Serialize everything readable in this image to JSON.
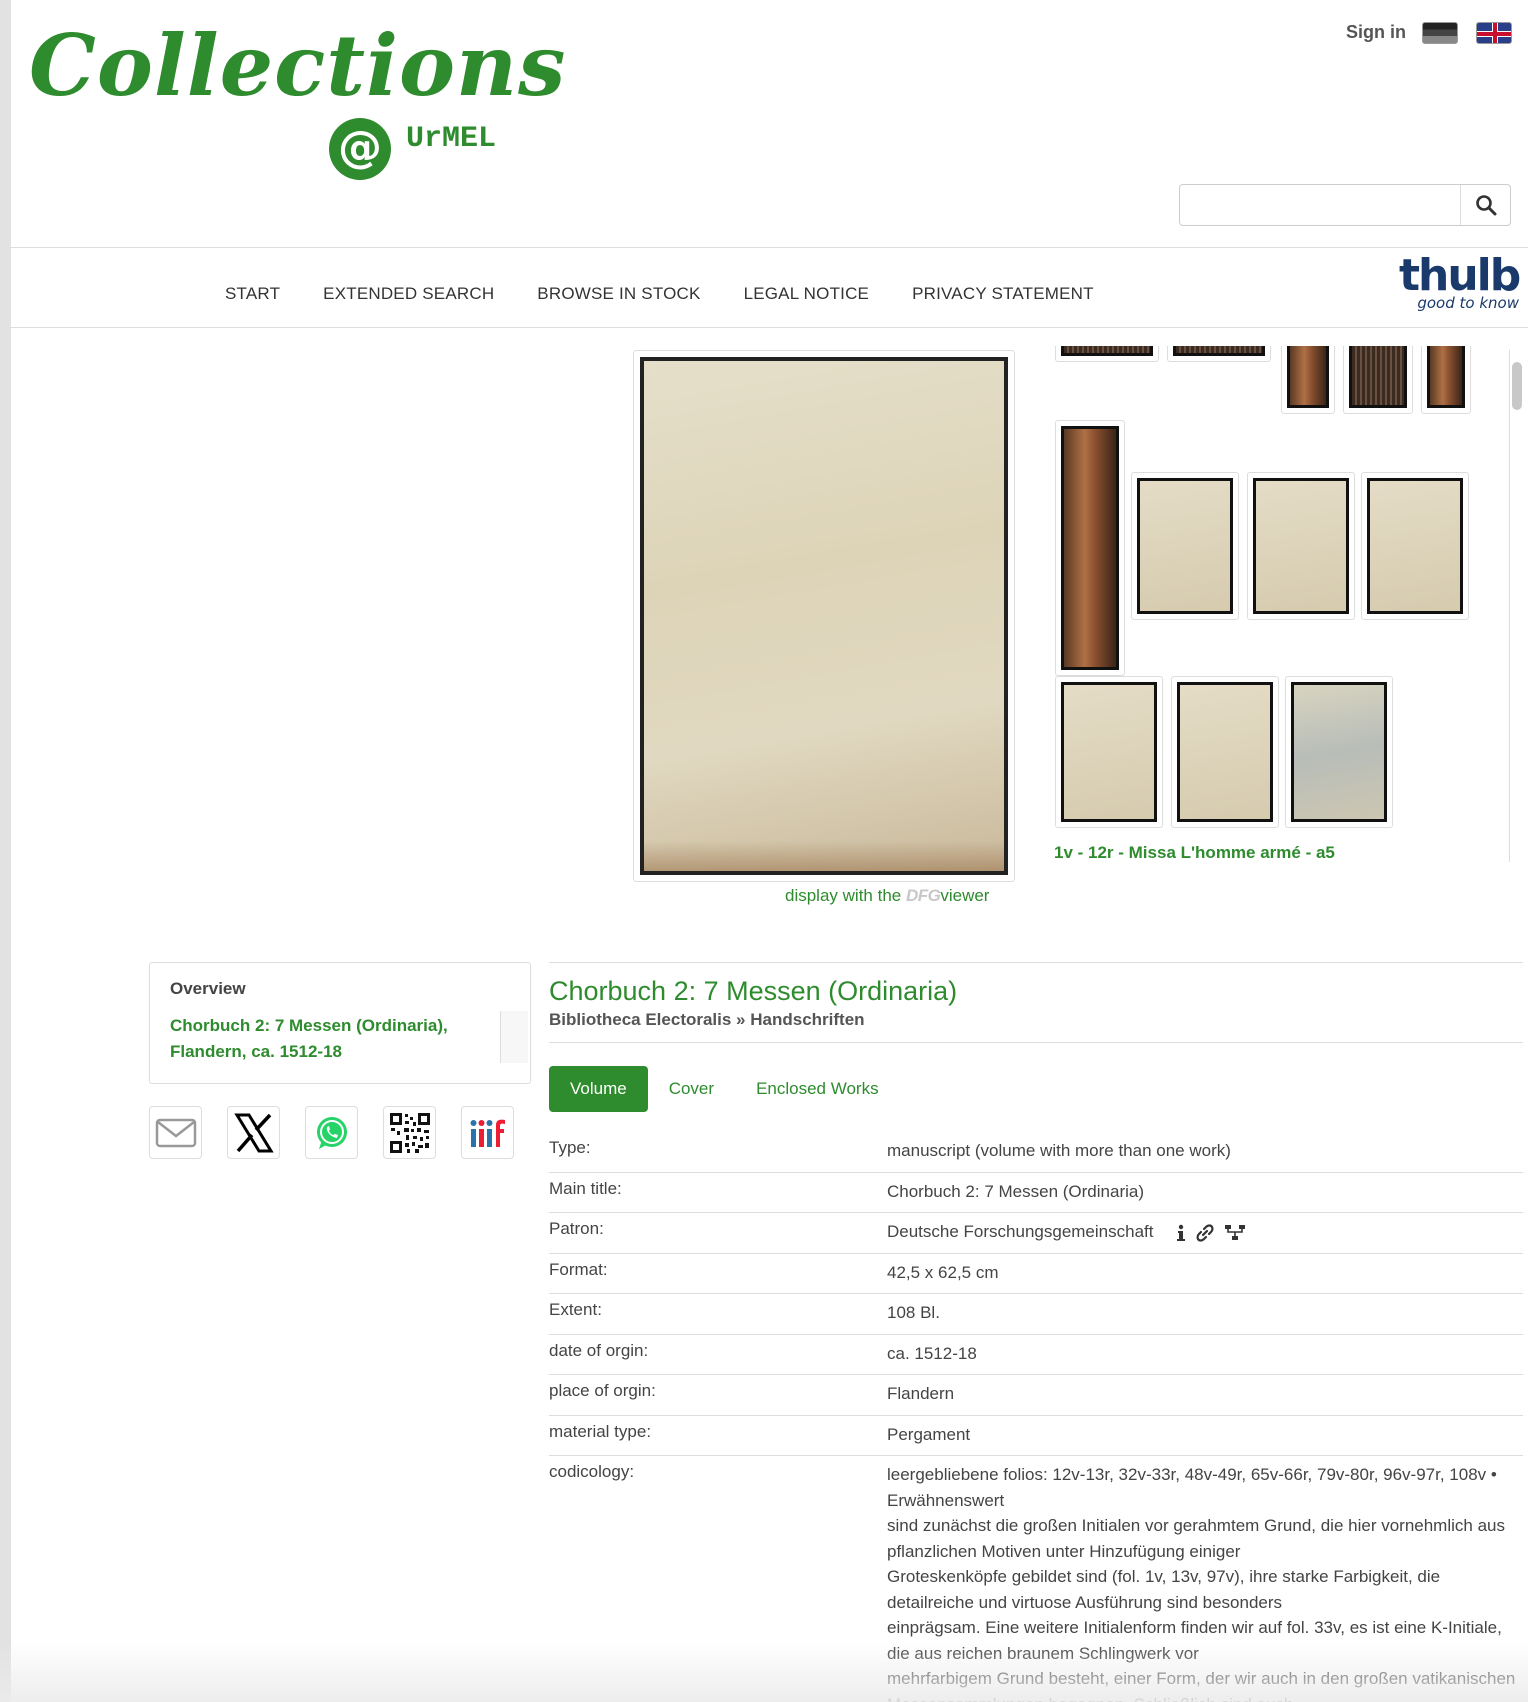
{
  "header": {
    "logo_script": "Collections",
    "logo_at": "@",
    "logo_sub": "UrMEL",
    "signin": "Sign in",
    "flag_de": "german-flag",
    "flag_uk": "uk-flag",
    "search": {
      "placeholder": "",
      "value": ""
    }
  },
  "nav": {
    "items": [
      "START",
      "EXTENDED SEARCH",
      "BROWSE IN STOCK",
      "LEGAL NOTICE",
      "PRIVACY STATEMENT"
    ]
  },
  "thulb": {
    "main": "thulb",
    "sub": "good to know"
  },
  "viewer": {
    "dfg_prefix": "display with the ",
    "dfg_mark": "DFG",
    "dfg_suffix": "viewer",
    "thumb_caption": "1v - 12r - Missa L'homme armé - a5"
  },
  "sidebar": {
    "overview_title": "Overview",
    "overview_link": "Chorbuch 2: 7 Messen (Ordinaria), Flandern, ca. 1512-18",
    "share": [
      "email-icon",
      "x-icon",
      "whatsapp-icon",
      "qr-code-icon",
      "iiif-icon"
    ]
  },
  "detail": {
    "title": "Chorbuch 2: 7 Messen (Ordinaria)",
    "breadcrumb": "Bibliotheca Electoralis » Handschriften",
    "tabs": [
      "Volume",
      "Cover",
      "Enclosed Works"
    ],
    "rows": [
      {
        "key": "Type:",
        "value": "manuscript (volume with more than one work)"
      },
      {
        "key": "Main title:",
        "value": "Chorbuch 2: 7 Messen (Ordinaria)"
      },
      {
        "key": "Patron:",
        "value": "Deutsche Forschungsgemeinschaft"
      },
      {
        "key": "Format:",
        "value": "42,5 x 62,5 cm"
      },
      {
        "key": "Extent:",
        "value": "108 Bl."
      },
      {
        "key": "date of orgin:",
        "value": "ca. 1512-18"
      },
      {
        "key": "place of orgin:",
        "value": "Flandern"
      },
      {
        "key": "material type:",
        "value": "Pergament"
      },
      {
        "key": "codicology:",
        "value": "leergebliebene folios: 12v-13r, 32v-33r, 48v-49r, 65v-66r, 79v-80r, 96v-97r, 108v • Erwähnenswert\nsind zunächst die großen Initialen vor gerahmtem Grund, die hier vornehmlich aus pflanzlichen Motiven unter Hinzufügung einiger\nGroteskenköpfe gebildet sind (fol. 1v, 13v, 97v), ihre starke Farbigkeit, die detailreiche und virtuose Ausführung sind besonders\neinprägsam. Eine weitere Initialenform finden wir auf fol. 33v, es ist eine K-Initiale, die aus reichen braunem Schlingwerk vor\nmehrfarbigem Grund besteht, einer Form, der wir auch in den großen vatikanischen Messensammlungen begegnen. Schließlich sind auch\nkira: die geschafts Schlänge und kleinen Cadeln Initialen zu fül"
      }
    ],
    "patron_icons": [
      "info-icon",
      "link-icon",
      "hierarchy-icon"
    ]
  },
  "colors": {
    "accent": "#2e8b2e",
    "navy": "#1a3a6b"
  }
}
